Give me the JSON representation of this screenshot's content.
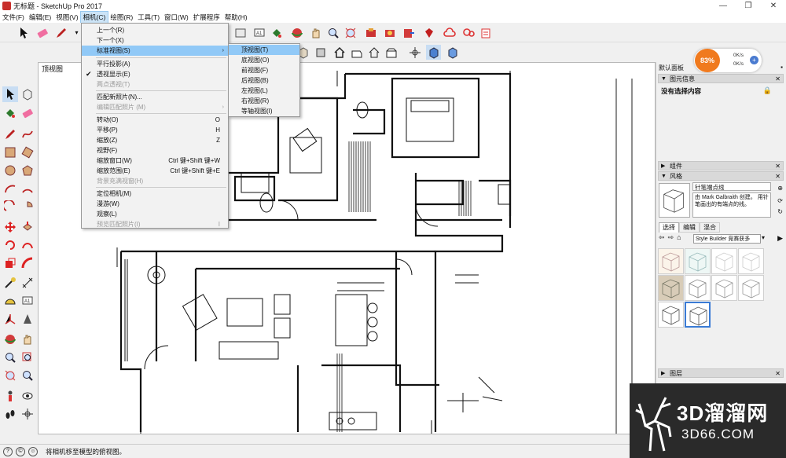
{
  "window": {
    "title": "无标题 - SketchUp Pro 2017",
    "minimize": "—",
    "maximize": "❐",
    "close": "✕"
  },
  "menubar": [
    {
      "label": "文件(F)"
    },
    {
      "label": "编辑(E)"
    },
    {
      "label": "视图(V)"
    },
    {
      "label": "相机(C)",
      "active": true
    },
    {
      "label": "绘图(R)"
    },
    {
      "label": "工具(T)"
    },
    {
      "label": "窗口(W)"
    },
    {
      "label": "扩展程序"
    },
    {
      "label": "帮助(H)"
    }
  ],
  "scene_tab": "顶视图",
  "camera_menu": {
    "items": [
      {
        "label": "上一个(R)"
      },
      {
        "label": "下一个(X)"
      },
      {
        "label": "标准视图(S)",
        "highlight": true,
        "submenu": true
      },
      {
        "label": "平行投影(A)"
      },
      {
        "label": "透视显示(E)",
        "checked": true
      },
      {
        "label": "两点透视(T)",
        "disabled": true
      },
      {
        "label": "匹配新照片(N)..."
      },
      {
        "label": "编辑匹配照片 (M)",
        "disabled": true,
        "submenu": true
      },
      {
        "label": "转动(O)",
        "shortcut": "O"
      },
      {
        "label": "平移(P)",
        "shortcut": "H"
      },
      {
        "label": "缩放(Z)",
        "shortcut": "Z"
      },
      {
        "label": "视野(F)"
      },
      {
        "label": "缩放窗口(W)",
        "shortcut": "Ctrl 键+Shift 键+W"
      },
      {
        "label": "缩放范围(E)",
        "shortcut": "Ctrl 键+Shift 键+E"
      },
      {
        "label": "背景充满视窗(H)",
        "disabled": true
      },
      {
        "label": "定位相机(M)"
      },
      {
        "label": "漫游(W)"
      },
      {
        "label": "观察(L)"
      },
      {
        "label": "预览匹配照片(I)",
        "disabled": true,
        "shortcut": "I"
      }
    ]
  },
  "standard_views_menu": {
    "items": [
      {
        "label": "顶视图(T)",
        "highlight": true
      },
      {
        "label": "底视图(O)"
      },
      {
        "label": "前视图(F)"
      },
      {
        "label": "后视图(B)"
      },
      {
        "label": "左视图(L)"
      },
      {
        "label": "右视图(R)"
      },
      {
        "label": "等轴视图(I)"
      }
    ]
  },
  "tray": {
    "title": "默认面板",
    "entity_info": {
      "header": "图元信息",
      "text": "没有选择内容"
    },
    "components_header": "组件",
    "styles_header": "风格",
    "style_name": "针笔端点线",
    "style_desc": "由 Mark Galbraith 创建。 用针笔画出的有端点的线。",
    "tabs": [
      "选择",
      "编辑",
      "混合"
    ],
    "style_dropdown": "Style Builder 竞赛获多",
    "layers_header": "图层"
  },
  "net_widget": {
    "percent": "83%",
    "up": "0K/s",
    "down": "0K/s",
    "plus": "+"
  },
  "status": {
    "text": "将相机移至模型的俯视图。"
  },
  "watermark": {
    "main": "3D溜溜网",
    "sub": "3D66.COM"
  },
  "colors": {
    "menu_highlight": "#91c9f7",
    "accent": "#f07a1e"
  }
}
